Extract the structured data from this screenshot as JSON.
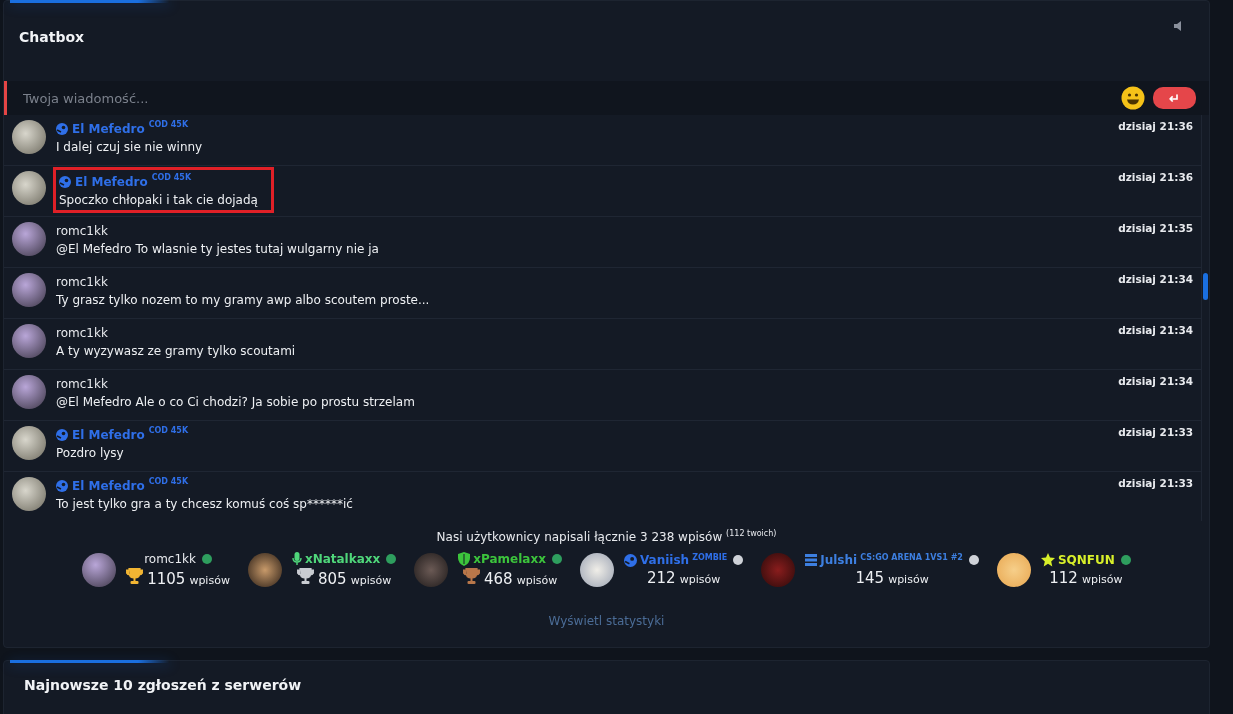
{
  "chatbox": {
    "title": "Chatbox",
    "sound_on": false,
    "input": {
      "placeholder": "Twoja wiadomość...",
      "send_label": "↵"
    },
    "messages": [
      {
        "author": "El Mefedro",
        "kind": "steam",
        "badge": "COD 45K",
        "text": "I dalej czuj sie nie winny",
        "time": "dzisiaj 21:36",
        "highlighted": false
      },
      {
        "author": "El Mefedro",
        "kind": "steam",
        "badge": "COD 45K",
        "text": "Spoczko chłopaki i tak cie dojadą",
        "time": "dzisiaj 21:36",
        "highlighted": true
      },
      {
        "author": "romc1kk",
        "kind": "plain",
        "text": "@El Mefedro To wlasnie ty jestes tutaj wulgarny nie ja",
        "time": "dzisiaj 21:35",
        "highlighted": false
      },
      {
        "author": "romc1kk",
        "kind": "plain",
        "text": "Ty grasz tylko nozem to my gramy awp albo scoutem proste...",
        "time": "dzisiaj 21:34",
        "highlighted": false
      },
      {
        "author": "romc1kk",
        "kind": "plain",
        "text": "A ty wyzywasz ze gramy tylko scoutami",
        "time": "dzisiaj 21:34",
        "highlighted": false
      },
      {
        "author": "romc1kk",
        "kind": "plain",
        "text": "@El Mefedro Ale o co Ci chodzi? Ja sobie po prostu strzelam",
        "time": "dzisiaj 21:34",
        "highlighted": false
      },
      {
        "author": "El Mefedro",
        "kind": "steam",
        "badge": "COD 45K",
        "text": "Pozdro lysy",
        "time": "dzisiaj 21:33",
        "highlighted": false
      },
      {
        "author": "El Mefedro",
        "kind": "steam",
        "badge": "COD 45K",
        "text": "To jest tylko gra a ty chcesz komuś coś sp******ić",
        "time": "dzisiaj 21:33",
        "highlighted": false
      }
    ],
    "summary": "Nasi użytkownicy napisali łącznie 3 238 wpisów $^{(112 twoich)}$",
    "top_users": [
      {
        "name": "romc1kk",
        "kind": "plain",
        "color": "#e8eaee",
        "trophy": {
          "color": "#f2b533"
        },
        "online": true,
        "count": "1105",
        "unit": "wpisów"
      },
      {
        "name": "xNatalkaxx",
        "kind": "mic",
        "color": "#4fd67a",
        "trophy": {
          "color": "#c9ccd2"
        },
        "online": true,
        "count": "805",
        "unit": "wpisów"
      },
      {
        "name": "xPamelaxx",
        "kind": "shield",
        "color": "#3cc43c",
        "trophy": {
          "color": "#b9774a"
        },
        "online": true,
        "count": "468",
        "unit": "wpisów"
      },
      {
        "name": "Vaniish",
        "kind": "steam",
        "color": "#2f6fe8",
        "badge": "ZOMBIE",
        "online": false,
        "count": "212",
        "unit": "wpisów"
      },
      {
        "name": "Julshi",
        "kind": "server",
        "color": "#3d7fe0",
        "badge": "CS:GO ARENA 1VS1 #2",
        "online": false,
        "count": "145",
        "unit": "wpisów"
      },
      {
        "name": "SQNFUN",
        "kind": "star",
        "color": "#d8ef2a",
        "online": true,
        "count": "112",
        "unit": "wpisów"
      }
    ],
    "stats_link": "Wyświetl statystyki"
  },
  "reports": {
    "title": "Najnowsze 10 zgłoszeń z serwerów"
  }
}
